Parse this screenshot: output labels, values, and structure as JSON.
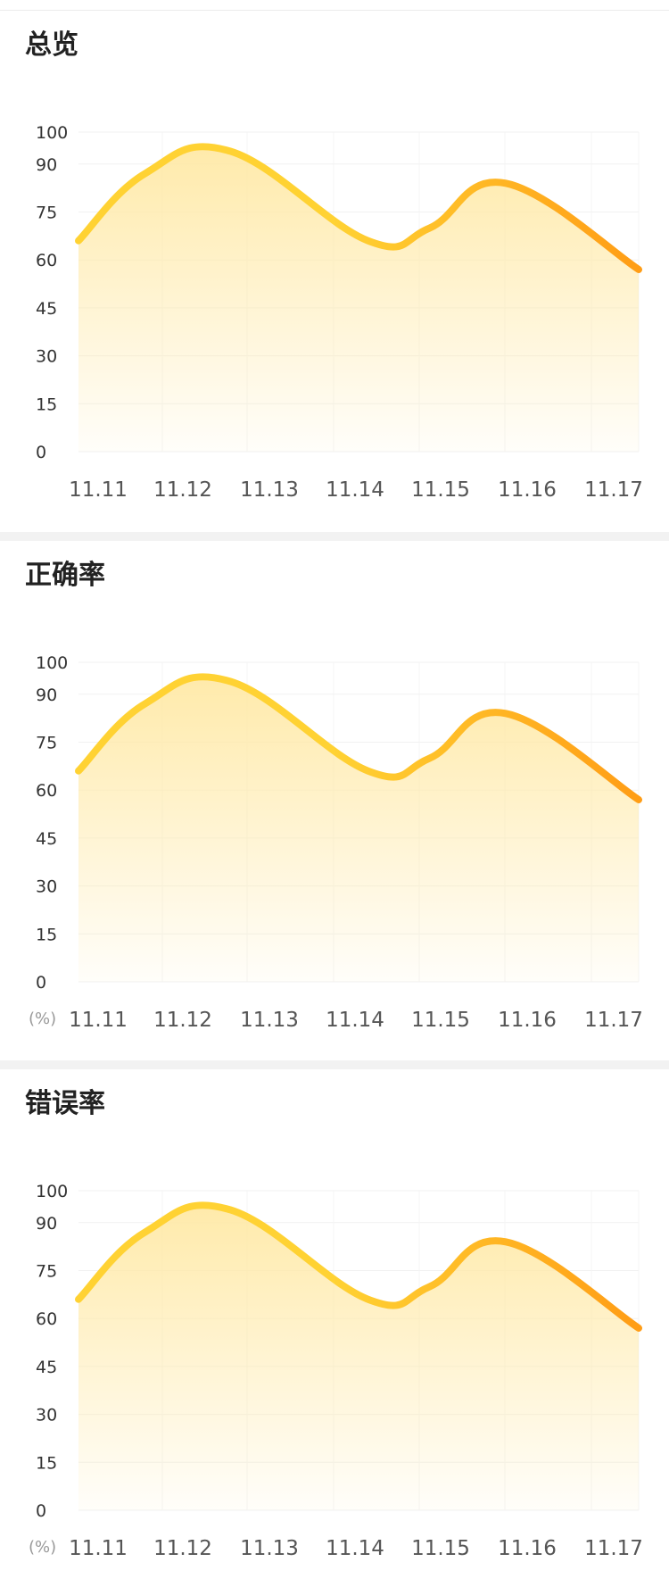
{
  "panels": [
    {
      "title": "总览",
      "unit": "",
      "chart_data": {
        "type": "area",
        "categories": [
          "11.11",
          "11.12",
          "11.13",
          "11.14",
          "11.15",
          "11.16",
          "11.17"
        ],
        "x_positions": [
          0.3,
          1.0,
          1.9,
          3.35,
          4.0,
          4.8,
          6.2
        ],
        "series": [
          {
            "values": [
              66,
              87,
              94,
              66,
              70,
              84,
              57
            ]
          }
        ],
        "y_ticks": [
          0,
          15,
          30,
          45,
          60,
          75,
          90,
          100
        ],
        "ylim": [
          0,
          100
        ],
        "grid": true,
        "line_gradient": [
          "#FFD233",
          "#FF9D16"
        ],
        "fill_color": "#FFE9A6"
      }
    },
    {
      "title": "正确率",
      "unit": "(%)",
      "chart_data": {
        "type": "area",
        "categories": [
          "11.11",
          "11.12",
          "11.13",
          "11.14",
          "11.15",
          "11.16",
          "11.17"
        ],
        "x_positions": [
          0.3,
          1.0,
          1.9,
          3.35,
          4.0,
          4.8,
          6.2
        ],
        "series": [
          {
            "values": [
              66,
              87,
              94,
              66,
              70,
              84,
              57
            ]
          }
        ],
        "y_ticks": [
          0,
          15,
          30,
          45,
          60,
          75,
          90,
          100
        ],
        "ylim": [
          0,
          100
        ],
        "grid": true,
        "line_gradient": [
          "#FFD233",
          "#FF9D16"
        ],
        "fill_color": "#FFE9A6"
      }
    },
    {
      "title": "错误率",
      "unit": "(%)",
      "chart_data": {
        "type": "area",
        "categories": [
          "11.11",
          "11.12",
          "11.13",
          "11.14",
          "11.15",
          "11.16",
          "11.17"
        ],
        "x_positions": [
          0.3,
          1.0,
          1.9,
          3.35,
          4.0,
          4.8,
          6.2
        ],
        "series": [
          {
            "values": [
              66,
              87,
              94,
              66,
              70,
              84,
              57
            ]
          }
        ],
        "y_ticks": [
          0,
          15,
          30,
          45,
          60,
          75,
          90,
          100
        ],
        "ylim": [
          0,
          100
        ],
        "grid": true,
        "line_gradient": [
          "#FFD233",
          "#FF9D16"
        ],
        "fill_color": "#FFE9A6"
      }
    }
  ]
}
